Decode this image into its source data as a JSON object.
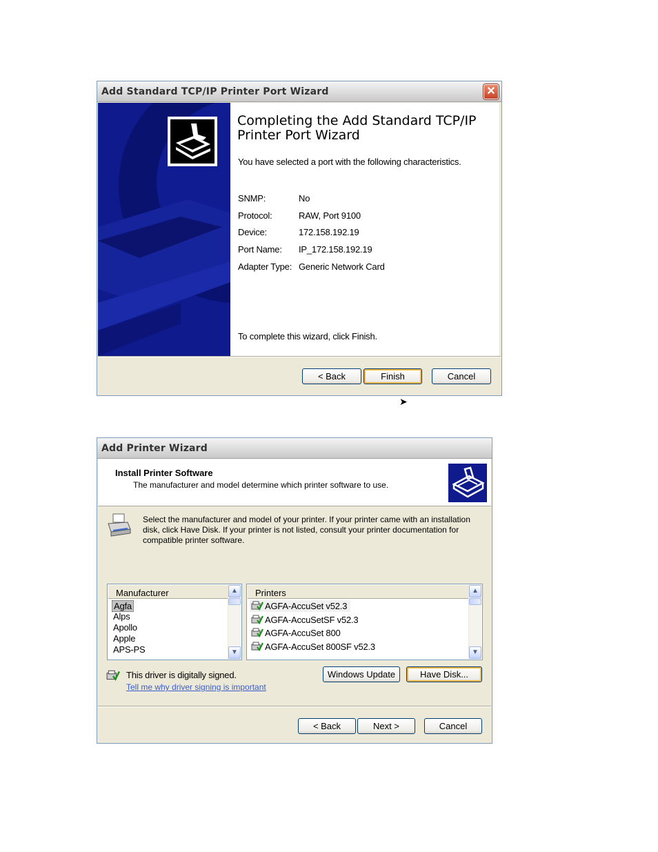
{
  "wizard1": {
    "title": "Add Standard TCP/IP Printer Port Wizard",
    "close_glyph": "✕",
    "heading": "Completing the Add Standard TCP/IP Printer Port Wizard",
    "intro": "You have selected a port with the following characteristics.",
    "fields": [
      {
        "label": "SNMP:",
        "value": "No"
      },
      {
        "label": "Protocol:",
        "value": "RAW, Port 9100"
      },
      {
        "label": "Device:",
        "value": "172.158.192.19"
      },
      {
        "label": "Port Name:",
        "value": "IP_172.158.192.19"
      },
      {
        "label": "Adapter Type:",
        "value": "Generic Network Card"
      }
    ],
    "finish_hint": "To complete this wizard, click Finish.",
    "buttons": {
      "back": "< Back",
      "finish": "Finish",
      "cancel": "Cancel"
    }
  },
  "arrow_glyph": "➤",
  "wizard2": {
    "title": "Add Printer Wizard",
    "header_title": "Install Printer Software",
    "header_subtitle": "The manufacturer and model determine which printer software to use.",
    "instructions": [
      "Select the manufacturer and model of your printer. If your printer came with an installation",
      "disk, click Have Disk. If your printer is not listed, consult your printer documentation for",
      "compatible printer software."
    ],
    "manufacturer_header": "Manufacturer",
    "manufacturers": [
      "Agfa",
      "Alps",
      "Apollo",
      "Apple",
      "APS-PS"
    ],
    "printers_header": "Printers",
    "printers": [
      "AGFA-AccuSet v52.3",
      "AGFA-AccuSetSF v52.3",
      "AGFA-AccuSet 800",
      "AGFA-AccuSet 800SF v52.3"
    ],
    "signed_text": "This driver is digitally signed.",
    "signing_link": "Tell me why driver signing is important",
    "buttons": {
      "windows_update": "Windows Update",
      "have_disk": "Have Disk...",
      "back": "< Back",
      "next": "Next >",
      "cancel": "Cancel"
    },
    "scroll_up": "▲",
    "scroll_down": "▼"
  },
  "colors": {
    "sidebar": "#0f1a8c",
    "default_button_glow": "#f1b744",
    "link": "#3a5dcc",
    "selection": "#c2c2c2"
  }
}
